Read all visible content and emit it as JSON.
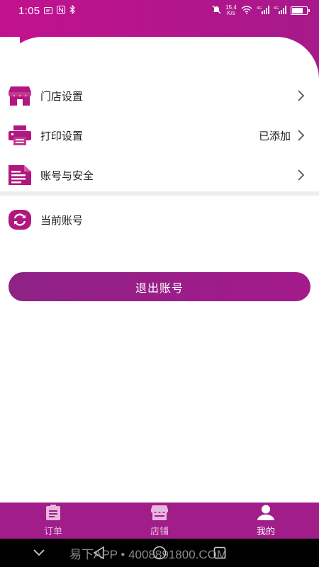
{
  "status_bar": {
    "time": "1:05",
    "net_speed_top": "15.4",
    "net_speed_bottom": "K/s",
    "signal_1": "4G",
    "signal_2": "4G"
  },
  "menu": [
    {
      "label": "门店设置",
      "value": "",
      "icon": "store-icon"
    },
    {
      "label": "打印设置",
      "value": "已添加",
      "icon": "printer-icon"
    },
    {
      "label": "账号与安全",
      "value": "",
      "icon": "document-icon"
    }
  ],
  "switch_account": {
    "label": "当前账号",
    "icon": "switch-icon"
  },
  "logout": {
    "label": "退出账号"
  },
  "tabs": [
    {
      "label": "订单",
      "icon": "clipboard-icon",
      "active": false
    },
    {
      "label": "店铺",
      "icon": "shop-icon",
      "active": false
    },
    {
      "label": "我的",
      "icon": "user-icon",
      "active": true
    }
  ],
  "watermark": "易下APP • 4008891800.COM",
  "colors": {
    "brand": "#a41a8b",
    "header": "#c2118f",
    "tab_bar": "#a11d8a",
    "icon": "#b0177f"
  }
}
